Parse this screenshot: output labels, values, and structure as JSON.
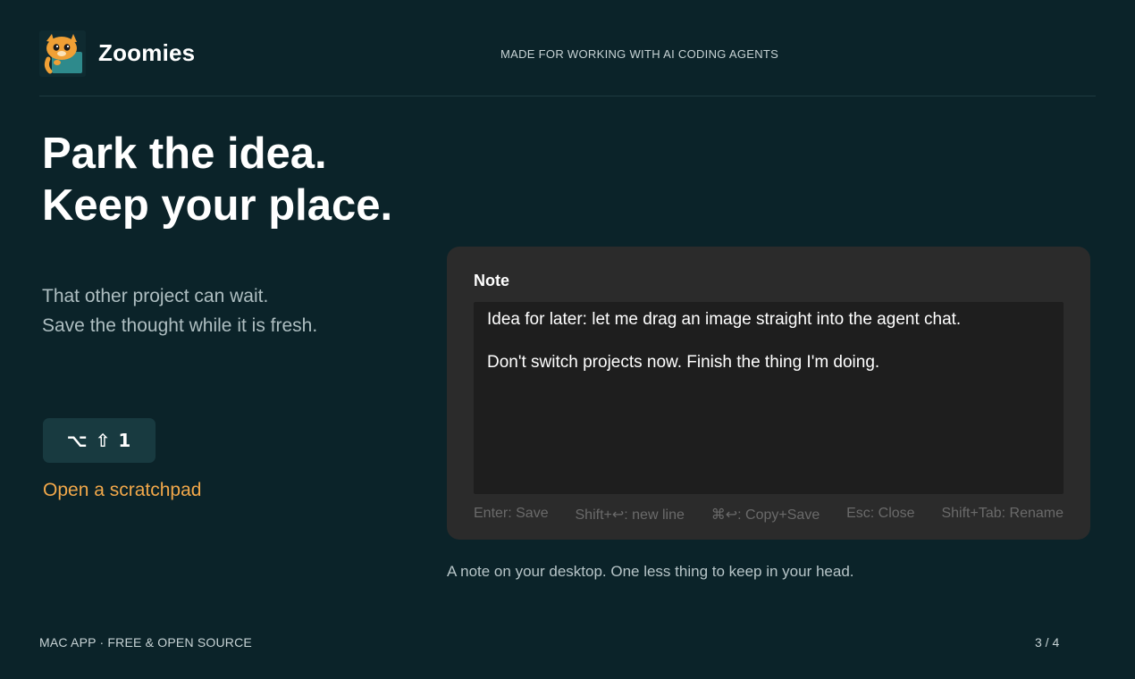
{
  "header": {
    "app_name": "Zoomies",
    "tagline": "MADE FOR WORKING WITH AI CODING AGENTS",
    "logo_icon": "cat-mascot-icon"
  },
  "hero": {
    "headline_line1": "Park the idea.",
    "headline_line2": "Keep your place.",
    "sub_line1": "That other project can wait.",
    "sub_line2": "Save the thought while it is fresh."
  },
  "shortcut": {
    "keys": "⌥ ⇧ 1",
    "link_label": "Open a scratchpad"
  },
  "note": {
    "title": "Note",
    "line1": "Idea for later: let me drag an image straight into the agent chat.",
    "line2": "Don't switch projects now. Finish the thing I'm doing.",
    "hints": [
      "Enter: Save",
      "Shift+↩: new line",
      "⌘↩: Copy+Save",
      "Esc: Close",
      "Shift+Tab: Rename"
    ]
  },
  "caption": "A note on your desktop. One less thing to keep in your head.",
  "footer": {
    "left": "MAC APP · FREE & OPEN SOURCE",
    "page": "3 / 4"
  },
  "colors": {
    "background": "#0b2329",
    "accent": "#f2a84a",
    "note_window": "#2b2b2b",
    "note_textarea": "#1e1e1e"
  }
}
